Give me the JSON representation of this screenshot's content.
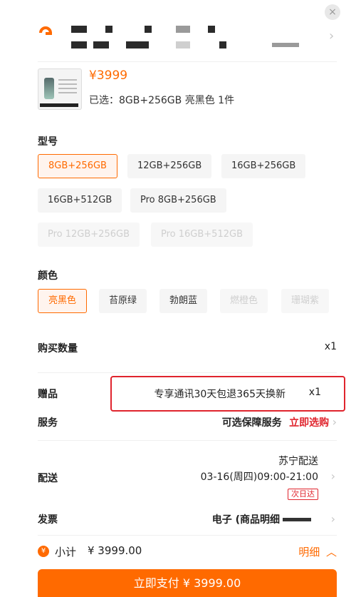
{
  "close_label": "×",
  "product": {
    "price": "¥3999",
    "selected_text": "已选：8GB+256GB 亮黑色 1件"
  },
  "model": {
    "title": "型号",
    "options": [
      "8GB+256GB",
      "12GB+256GB",
      "16GB+256GB",
      "16GB+512GB",
      "Pro 8GB+256GB",
      "Pro 12GB+256GB",
      "Pro 16GB+512GB"
    ],
    "selected": "8GB+256GB",
    "disabled": [
      "Pro 12GB+256GB",
      "Pro 16GB+512GB"
    ]
  },
  "color": {
    "title": "颜色",
    "options": [
      "亮黑色",
      "苔原绿",
      "勃朗蓝",
      "燃橙色",
      "珊瑚紫"
    ],
    "selected": "亮黑色",
    "disabled": [
      "燃橙色",
      "珊瑚紫"
    ]
  },
  "quantity": {
    "label": "购买数量",
    "value": "x1"
  },
  "gift": {
    "label": "赠品",
    "value": "专享通讯30天包退365天换新",
    "qty": "x1"
  },
  "service": {
    "label": "服务",
    "value": "可选保障服务",
    "action": "立即选购"
  },
  "delivery": {
    "label": "配送",
    "provider": "苏宁配送",
    "time": "03-16(周四)09:00-21:00",
    "badge": "次日达"
  },
  "invoice": {
    "label": "发票",
    "value": "电子 (商品明细"
  },
  "footer": {
    "subtotal_label": "小计",
    "subtotal_value": "¥ 3999.00",
    "detail_label": "明细",
    "pay_label": "立即支付 ¥ 3999.00"
  },
  "colors": {
    "accent": "#ff6a00",
    "highlight_border": "#e0242d"
  }
}
